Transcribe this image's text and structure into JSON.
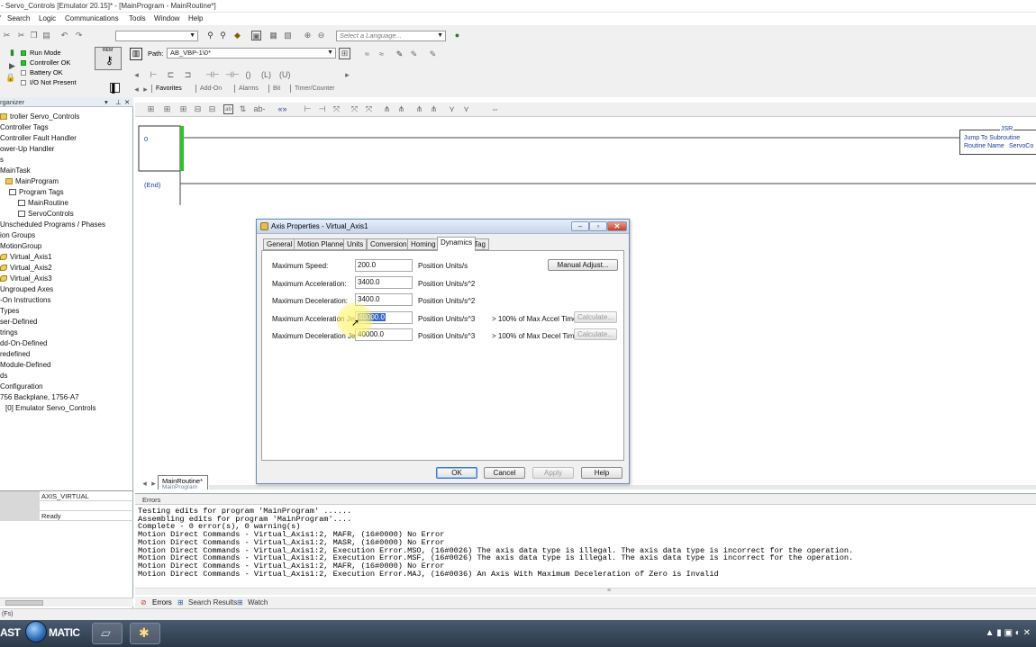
{
  "window": {
    "title": "- Servo_Controls [Emulator 20.15]* - [MainProgram - MainRoutine*]"
  },
  "menu": [
    "Search",
    "Logic",
    "Communications",
    "Tools",
    "Window",
    "Help"
  ],
  "toolbar": {
    "routine_combo": "",
    "language_placeholder": "Select a Language...",
    "path_label": "Path:",
    "path_value": "AB_VBP-1\\0*",
    "status": {
      "run_mode": "Run Mode",
      "controller_ok": "Controller OK",
      "battery_ok": "Battery OK",
      "io": "I/O Not Present"
    },
    "key_label": "REM",
    "ladder_tabs": [
      "Favorites",
      "Add-On",
      "Alarms",
      "Bit",
      "Timer/Counter"
    ]
  },
  "organizer": {
    "title": "rganizer",
    "items": [
      {
        "label": "troller Servo_Controls",
        "icon": "folder-icon"
      },
      {
        "label": "Controller Tags",
        "icon": "none"
      },
      {
        "label": "Controller Fault Handler",
        "icon": "none"
      },
      {
        "label": "ower-Up Handler",
        "icon": "none"
      },
      {
        "label": "s",
        "icon": "none"
      },
      {
        "label": "MainTask",
        "icon": "none"
      },
      {
        "label": "MainProgram",
        "icon": "folder-icon"
      },
      {
        "label": "Program Tags",
        "icon": "doc-icon"
      },
      {
        "label": "MainRoutine",
        "icon": "doc-icon"
      },
      {
        "label": "ServoControls",
        "icon": "doc-icon"
      },
      {
        "label": "Unscheduled Programs / Phases",
        "icon": "none"
      },
      {
        "label": "ion Groups",
        "icon": "none"
      },
      {
        "label": "MotionGroup",
        "icon": "none"
      },
      {
        "label": "Virtual_Axis1",
        "icon": "axis-icon"
      },
      {
        "label": "Virtual_Axis2",
        "icon": "axis-icon"
      },
      {
        "label": "Virtual_Axis3",
        "icon": "axis-icon"
      },
      {
        "label": "Ungrouped Axes",
        "icon": "none"
      },
      {
        "label": "-On Instructions",
        "icon": "none"
      },
      {
        "label": "Types",
        "icon": "none"
      },
      {
        "label": "ser-Defined",
        "icon": "none"
      },
      {
        "label": "trings",
        "icon": "none"
      },
      {
        "label": "dd-On-Defined",
        "icon": "none"
      },
      {
        "label": "redefined",
        "icon": "none"
      },
      {
        "label": "Module-Defined",
        "icon": "none"
      },
      {
        "label": "ds",
        "icon": "none"
      },
      {
        "label": "Configuration",
        "icon": "none"
      },
      {
        "label": "756 Backplane, 1756-A7",
        "icon": "none"
      },
      {
        "label": "[0] Emulator Servo_Controls",
        "icon": "none"
      }
    ],
    "props": [
      {
        "value": "AXIS_VIRTUAL"
      },
      {
        "value": ""
      },
      {
        "value": "Ready"
      }
    ]
  },
  "editor": {
    "rung0": "0",
    "end": "(End)",
    "jsr": {
      "tag": "JSR",
      "title": "Jump To Subroutine",
      "routine_label": "Routine Name",
      "routine_value": "ServoCo"
    },
    "tab_name": "MainRoutine*",
    "tab_sub": "MainProgram"
  },
  "dialog": {
    "title": "Axis Properties - Virtual_Axis1",
    "tabs": [
      "General",
      "Motion Planner",
      "Units",
      "Conversion",
      "Homing",
      "Dynamics",
      "Tag"
    ],
    "active_tab": "Dynamics",
    "fields": [
      {
        "label": "Maximum Speed:",
        "value": "200.0",
        "unit": "Position Units/s",
        "note": ""
      },
      {
        "label": "Maximum Acceleration:",
        "value": "3400.0",
        "unit": "Position Units/s^2",
        "note": ""
      },
      {
        "label": "Maximum Deceleration:",
        "value": "3400.0",
        "unit": "Position Units/s^2",
        "note": ""
      },
      {
        "label": "Maximum Acceleration Jerk:",
        "value": "40000.0",
        "unit": "Position Units/s^3",
        "note": "> 100% of Max Accel Time"
      },
      {
        "label": "Maximum Deceleration Jerk:",
        "value": "40000.0",
        "unit": "Position Units/s^3",
        "note": "> 100% of Max Decel Time"
      }
    ],
    "manual_adjust": "Manual Adjust...",
    "calculate": "Calculate...",
    "buttons": {
      "ok": "OK",
      "cancel": "Cancel",
      "apply": "Apply",
      "help": "Help"
    }
  },
  "errors": {
    "title": "Errors",
    "lines": [
      "Testing edits for program 'MainProgram' ......",
      "Assembling edits for program 'MainProgram'....",
      "Complete - 0 error(s), 0 warning(s)",
      "Motion Direct Commands - Virtual_Axis1:2, MAFR, (16#0000) No Error",
      "Motion Direct Commands - Virtual_Axis1:2, MASR, (16#0000) No Error",
      "Motion Direct Commands - Virtual_Axis1:2, Execution Error.MSO, (16#0026) The axis data type is illegal.  The axis data type is incorrect for the operation.",
      "Motion Direct Commands - Virtual_Axis1:2, Execution Error.MSF, (16#0026) The axis data type is illegal.  The axis data type is incorrect for the operation.",
      "Motion Direct Commands - Virtual_Axis1:2, MAFR, (16#0000) No Error",
      "Motion Direct Commands - Virtual_Axis1:2, Execution Error.MAJ, (16#0036) An Axis With Maximum Deceleration of Zero is Invalid"
    ],
    "tabs": [
      "Errors",
      "Search Results",
      "Watch"
    ]
  },
  "statusbar": {
    "text": "(Fs)"
  },
  "taskbar": {
    "start_text": "AST",
    "start_text2": "MATIC"
  }
}
